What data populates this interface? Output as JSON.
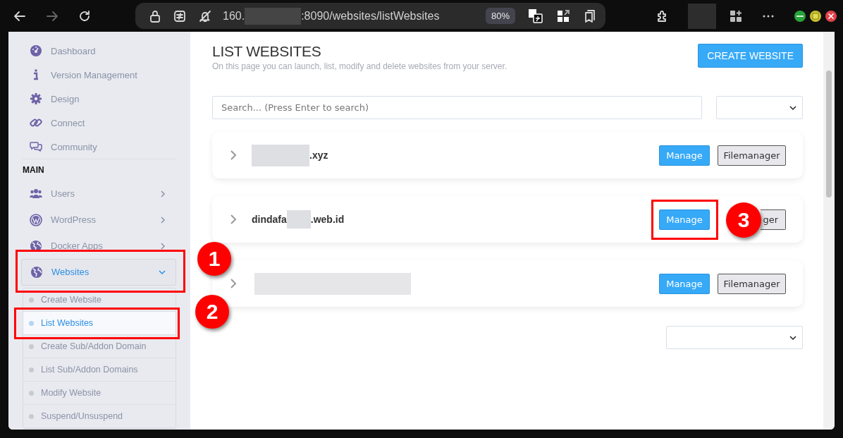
{
  "browser": {
    "address": {
      "start": "160.",
      "end": ":8090/websites/listWebsites",
      "redacted": true
    },
    "zoom": "80%"
  },
  "sidebar": {
    "top_items": [
      {
        "label": "Dashboard"
      },
      {
        "label": "Version Management"
      },
      {
        "label": "Design"
      },
      {
        "label": "Connect"
      },
      {
        "label": "Community"
      }
    ],
    "section": "MAIN",
    "menus": [
      {
        "label": "Users",
        "expanded": false
      },
      {
        "label": "WordPress",
        "expanded": false
      },
      {
        "label": "Docker Apps",
        "expanded": false
      },
      {
        "label": "Websites",
        "expanded": true,
        "callout": "1",
        "children": [
          {
            "label": "Create Website",
            "selected": false
          },
          {
            "label": "List Websites",
            "selected": true,
            "callout": "2"
          },
          {
            "label": "Create Sub/Addon Domain",
            "selected": false
          },
          {
            "label": "List Sub/Addon Domains",
            "selected": false
          },
          {
            "label": "Modify Website",
            "selected": false
          },
          {
            "label": "Suspend/Unsuspend",
            "selected": false
          }
        ]
      }
    ]
  },
  "page": {
    "title": "LIST WEBSITES",
    "subtitle": "On this page you can launch, list, modify and delete websites from your server.",
    "create_button": "CREATE WEBSITE",
    "search": {
      "placeholder": "Search... (Press Enter to search)"
    },
    "websites": [
      {
        "name_end": ".xyz",
        "redacted": true,
        "actions": [
          {
            "label": "Manage",
            "kind": "primary"
          },
          {
            "label": "Filemanager",
            "kind": "secondary"
          }
        ]
      },
      {
        "name_start": "dindafa",
        "name_end": ".web.id",
        "redacted": true,
        "actions": [
          {
            "label": "Manage",
            "kind": "primary",
            "callout": "3"
          },
          {
            "label": "ger",
            "kind": "secondary"
          }
        ]
      },
      {
        "redacted": true,
        "actions": [
          {
            "label": "Manage",
            "kind": "primary"
          },
          {
            "label": "Filemanager",
            "kind": "secondary"
          }
        ]
      }
    ]
  }
}
